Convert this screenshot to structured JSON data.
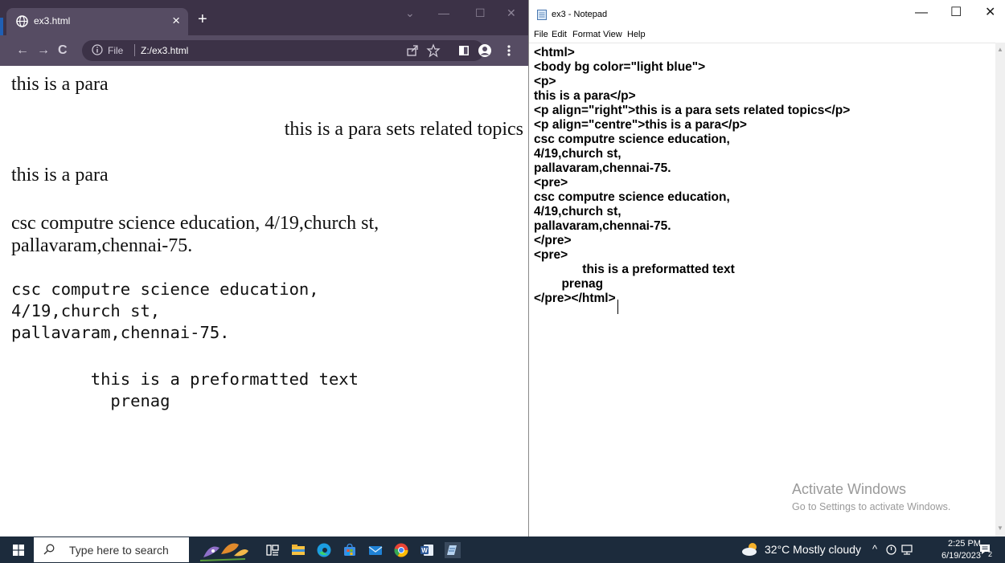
{
  "browser": {
    "tab_title": "ex3.html",
    "tab_close": "×",
    "new_tab": "+",
    "protocol_label": "File",
    "url": "Z:/ex3.html",
    "content": {
      "p1": "this is a para",
      "p2_right": "this is a para sets related topics",
      "p3": "this is a para",
      "address_line1": "csc computre science education, 4/19,church st,",
      "address_line2": "pallavaram,chennai-75.",
      "pre1_line1": "csc computre science education,",
      "pre1_line2": "4/19,church st,",
      "pre1_line3": "pallavaram,chennai-75.",
      "pre2_line1": "        this is a preformatted text",
      "pre2_line2": "          prenag"
    },
    "colors": {
      "tabstrip": "#3c3247",
      "toolbar": "#564c63"
    }
  },
  "notepad": {
    "title": "ex3 - Notepad",
    "menu": [
      "File",
      "Edit",
      "Format",
      "View",
      "Help"
    ],
    "lines": [
      "<html>",
      "<body bg color=\"light blue\">",
      "<p>",
      "this is a para</p>",
      "<p align=\"right\">this is a para sets related topics</p>",
      "<p align=\"centre\">this is a para</p>",
      "csc computre science education,",
      "4/19,church st,",
      "pallavaram,chennai-75.",
      "<pre>",
      "csc computre science education,",
      "4/19,church st,",
      "pallavaram,chennai-75.",
      "</pre>",
      "<pre>",
      "              this is a preformatted text",
      "        prenag",
      "</pre></html>"
    ],
    "watermark_title": "Activate Windows",
    "watermark_sub": "Go to Settings to activate Windows."
  },
  "taskbar": {
    "search_placeholder": "Type here to search",
    "weather": "32°C  Mostly cloudy",
    "time": "2:25 PM",
    "date": "6/19/2023",
    "notification_count": "2"
  }
}
